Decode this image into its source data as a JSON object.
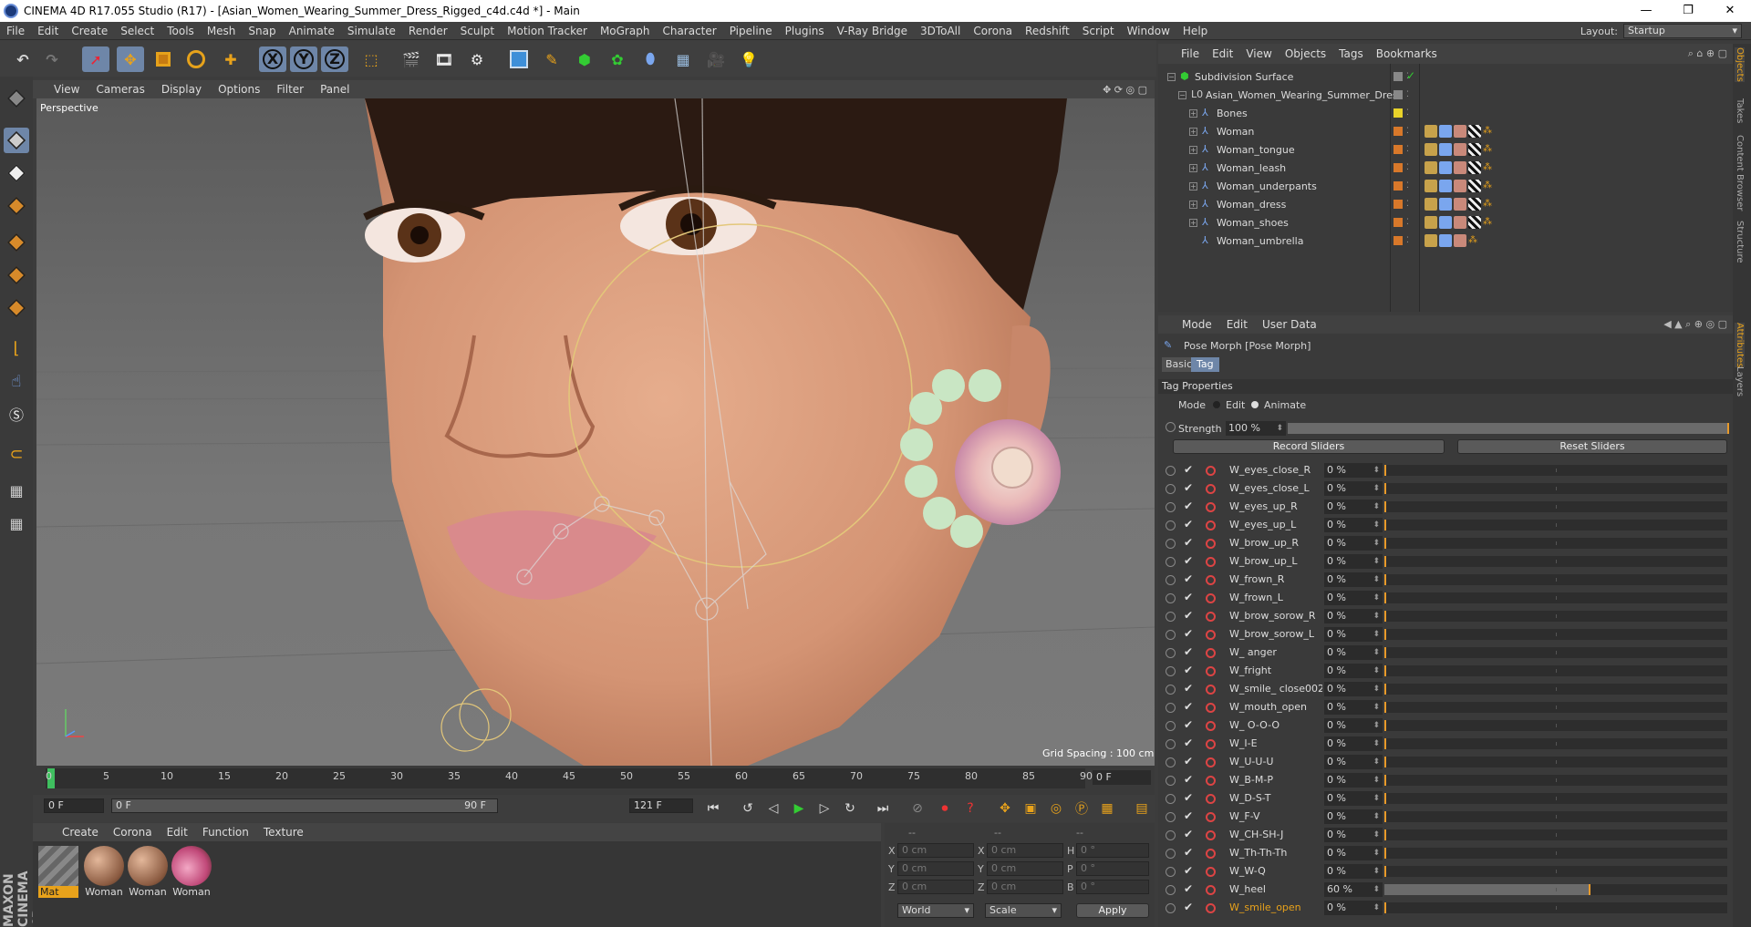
{
  "title": "CINEMA 4D R17.055 Studio (R17) - [Asian_Women_Wearing_Summer_Dress_Rigged_c4d.c4d *] - Main",
  "window_buttons": [
    "—",
    "❐",
    "✕"
  ],
  "menu": [
    "File",
    "Edit",
    "Create",
    "Select",
    "Tools",
    "Mesh",
    "Snap",
    "Animate",
    "Simulate",
    "Render",
    "Sculpt",
    "Motion Tracker",
    "MoGraph",
    "Character",
    "Pipeline",
    "Plugins",
    "V-Ray Bridge",
    "3DToAll",
    "Corona",
    "Redshift",
    "Script",
    "Window",
    "Help"
  ],
  "layout": {
    "label": "Layout:",
    "value": "Startup"
  },
  "toolbar": {
    "x": "X",
    "y": "Y",
    "z": "Z"
  },
  "viewport": {
    "menu": [
      "View",
      "Cameras",
      "Display",
      "Options",
      "Filter",
      "Panel"
    ],
    "label": "Perspective",
    "grid_spacing": "Grid Spacing : 100 cm"
  },
  "timeline": {
    "ticks": [
      "0",
      "5",
      "10",
      "15",
      "20",
      "25",
      "30",
      "35",
      "40",
      "45",
      "50",
      "55",
      "60",
      "65",
      "70",
      "75",
      "80",
      "85",
      "90"
    ],
    "current_frame": "0 F",
    "start_field": "0 F",
    "range_start": "0 F",
    "range_end": "90 F",
    "end_field": "121 F"
  },
  "material_manager": {
    "menu": [
      "Create",
      "Corona",
      "Edit",
      "Function",
      "Texture"
    ],
    "materials": [
      {
        "label": "Mat"
      },
      {
        "label": "Woman"
      },
      {
        "label": "Woman"
      },
      {
        "label": "Woman"
      }
    ]
  },
  "coordinates": {
    "headers": [
      "--",
      "--",
      "--"
    ],
    "rows": [
      {
        "a": "X",
        "av": "0 cm",
        "b": "X",
        "bv": "0 cm",
        "c": "H",
        "cv": "0 °"
      },
      {
        "a": "Y",
        "av": "0 cm",
        "b": "Y",
        "bv": "0 cm",
        "c": "P",
        "cv": "0 °"
      },
      {
        "a": "Z",
        "av": "0 cm",
        "b": "Z",
        "bv": "0 cm",
        "c": "B",
        "cv": "0 °"
      }
    ],
    "world": "World",
    "scale": "Scale",
    "apply": "Apply"
  },
  "brand": "MAXON CINEMA 4D",
  "object_manager": {
    "menu": [
      "File",
      "Edit",
      "View",
      "Objects",
      "Tags",
      "Bookmarks"
    ],
    "objects": [
      {
        "name": "Subdivision Surface",
        "level": 0,
        "color": "#888888"
      },
      {
        "name": "Asian_Women_Wearing_Summer_Dress",
        "level": 1,
        "color": "#888888"
      },
      {
        "name": "Bones",
        "level": 2,
        "color": "#e8d22a"
      },
      {
        "name": "Woman",
        "level": 2,
        "color": "#d8782a"
      },
      {
        "name": "Woman_tongue",
        "level": 2,
        "color": "#d8782a"
      },
      {
        "name": "Woman_leash",
        "level": 2,
        "color": "#d8782a"
      },
      {
        "name": "Woman_underpants",
        "level": 2,
        "color": "#d8782a"
      },
      {
        "name": "Woman_dress",
        "level": 2,
        "color": "#d8782a"
      },
      {
        "name": "Woman_shoes",
        "level": 2,
        "color": "#d8782a"
      },
      {
        "name": "Woman_umbrella",
        "level": 2,
        "color": "#d8782a"
      }
    ]
  },
  "attributes": {
    "menu": [
      "Mode",
      "Edit",
      "User Data"
    ],
    "object_title": "Pose Morph [Pose Morph]",
    "tabs": [
      "Basic",
      "Tag"
    ],
    "section": "Tag Properties",
    "mode_label": "Mode",
    "mode_edit": "Edit",
    "mode_animate": "Animate",
    "strength_label": "Strength",
    "strength_value": "100 %",
    "strength_fraction": 1.0,
    "record_sliders": "Record Sliders",
    "reset_sliders": "Reset Sliders",
    "poses": [
      {
        "name": "W_eyes_close_R",
        "value": "0 %",
        "fraction": 0
      },
      {
        "name": "W_eyes_close_L",
        "value": "0 %",
        "fraction": 0
      },
      {
        "name": "W_eyes_up_R",
        "value": "0 %",
        "fraction": 0
      },
      {
        "name": "W_eyes_up_L",
        "value": "0 %",
        "fraction": 0
      },
      {
        "name": "W_brow_up_R",
        "value": "0 %",
        "fraction": 0
      },
      {
        "name": "W_brow_up_L",
        "value": "0 %",
        "fraction": 0
      },
      {
        "name": "W_frown_R",
        "value": "0 %",
        "fraction": 0
      },
      {
        "name": "W_frown_L",
        "value": "0 %",
        "fraction": 0
      },
      {
        "name": "W_brow_sorow_R",
        "value": "0 %",
        "fraction": 0
      },
      {
        "name": "W_brow_sorow_L",
        "value": "0 %",
        "fraction": 0
      },
      {
        "name": "W_ anger",
        "value": "0 %",
        "fraction": 0
      },
      {
        "name": "W_fright",
        "value": "0 %",
        "fraction": 0
      },
      {
        "name": "W_smile_ close002",
        "value": "0 %",
        "fraction": 0
      },
      {
        "name": "W_mouth_open",
        "value": "0 %",
        "fraction": 0
      },
      {
        "name": "W_ O-O-O",
        "value": "0 %",
        "fraction": 0
      },
      {
        "name": "W_I-E",
        "value": "0 %",
        "fraction": 0
      },
      {
        "name": "W_U-U-U",
        "value": "0 %",
        "fraction": 0
      },
      {
        "name": "W_B-M-P",
        "value": "0 %",
        "fraction": 0
      },
      {
        "name": "W_D-S-T",
        "value": "0 %",
        "fraction": 0
      },
      {
        "name": "W_F-V",
        "value": "0 %",
        "fraction": 0
      },
      {
        "name": "W_CH-SH-J",
        "value": "0 %",
        "fraction": 0
      },
      {
        "name": "W_Th-Th-Th",
        "value": "0 %",
        "fraction": 0
      },
      {
        "name": "W_W-Q",
        "value": "0 %",
        "fraction": 0
      },
      {
        "name": "W_heel",
        "value": "60 %",
        "fraction": 0.6
      },
      {
        "name": "W_smile_open",
        "value": "0 %",
        "fraction": 0
      }
    ]
  },
  "right_tabs": [
    "Objects",
    "Takes",
    "Content Browser",
    "Structure",
    "Attributes",
    "Layers"
  ]
}
